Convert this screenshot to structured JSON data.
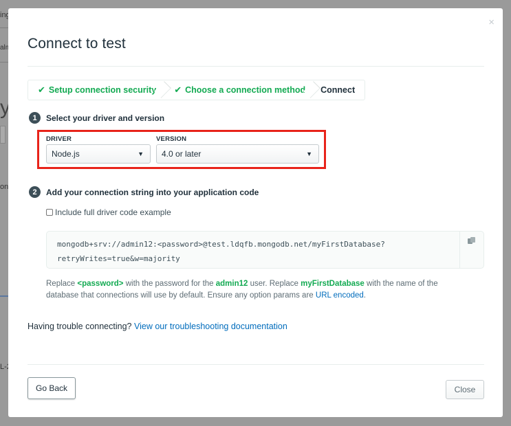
{
  "background": {
    "fragments": [
      "ing",
      "alm",
      "y",
      "on",
      "L-2"
    ]
  },
  "modal": {
    "title": "Connect to test",
    "close_glyph": "×"
  },
  "stepper": {
    "steps": [
      {
        "label": "Setup connection security",
        "state": "done"
      },
      {
        "label": "Choose a connection method",
        "state": "done"
      },
      {
        "label": "Connect",
        "state": "current"
      }
    ],
    "check_glyph": "✔"
  },
  "step1": {
    "number": "1",
    "label": "Select your driver and version",
    "driver": {
      "label": "DRIVER",
      "value": "Node.js"
    },
    "version": {
      "label": "VERSION",
      "value": "4.0 or later"
    }
  },
  "step2": {
    "number": "2",
    "label": "Add your connection string into your application code",
    "checkbox_label": "Include full driver code example",
    "checkbox_checked": false,
    "connection_string_line1": "mongodb+srv://admin12:<password>@test.ldqfb.mongodb.net/myFirstDatabase?",
    "connection_string_line2": "retryWrites=true&w=majority",
    "help": {
      "t1": "Replace ",
      "password_token": "<password>",
      "t2": " with the password for the ",
      "user": "admin12",
      "t3": " user. Replace ",
      "database": "myFirstDatabase",
      "t4": " with the name of the database that connections will use by default. Ensure any option params are ",
      "link": "URL encoded",
      "t5": "."
    }
  },
  "trouble": {
    "text": "Having trouble connecting?",
    "link": "View our troubleshooting documentation"
  },
  "footer": {
    "back_label": "Go Back",
    "close_label": "Close"
  },
  "colors": {
    "accent_green": "#13aa52",
    "link_blue": "#006cbc",
    "highlight_red": "#e8231a"
  },
  "icons": {
    "caret": "▼"
  }
}
